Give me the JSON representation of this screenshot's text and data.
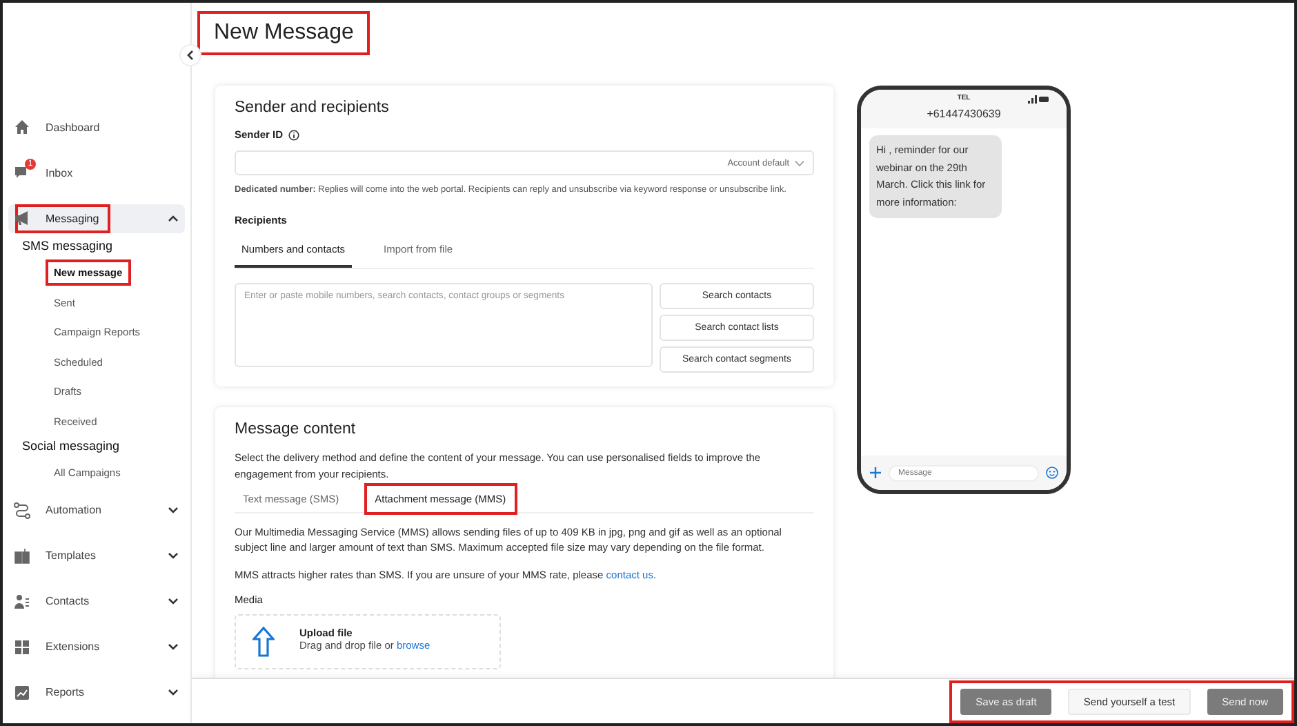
{
  "page": {
    "title": "New Message",
    "highlighted": true
  },
  "sidebar": {
    "items": [
      {
        "label": "Dashboard",
        "selected": false
      },
      {
        "label": "Inbox",
        "badge": "1",
        "selected": false
      },
      {
        "label": "Messaging",
        "selected": true,
        "expanded": true,
        "highlighted": true,
        "sections": [
          {
            "title": "SMS messaging",
            "children": [
              {
                "label": "New message",
                "selected": true,
                "highlighted": true
              },
              {
                "label": "Sent",
                "selected": false,
                "highlighted": false
              },
              {
                "label": "Campaign Reports",
                "selected": false,
                "highlighted": false
              },
              {
                "label": "Scheduled",
                "selected": false,
                "highlighted": false
              },
              {
                "label": "Drafts",
                "selected": false,
                "highlighted": false
              },
              {
                "label": "Received",
                "selected": false,
                "highlighted": false
              }
            ]
          },
          {
            "title": "Social messaging",
            "children": [
              {
                "label": "All Campaigns",
                "selected": false,
                "highlighted": false
              }
            ]
          }
        ]
      },
      {
        "label": "Automation",
        "selected": false,
        "expanded": false
      },
      {
        "label": "Templates",
        "selected": false,
        "expanded": false
      },
      {
        "label": "Contacts",
        "selected": false,
        "expanded": false
      },
      {
        "label": "Extensions",
        "selected": false,
        "expanded": false
      },
      {
        "label": "Reports",
        "selected": false,
        "expanded": false
      }
    ]
  },
  "sender_card": {
    "title": "Sender and recipients",
    "sender_label": "Sender ID",
    "sender_value": "Account default",
    "note": "**Dedicated number:** Replies will come into the web portal. Recipients can reply and unsubscribe via keyword response or unsubscribe link.",
    "recipients_label": "Recipients",
    "tabs": [
      {
        "label": "Numbers and contacts",
        "selected": true
      },
      {
        "label": "Import from file",
        "selected": false
      }
    ],
    "recipients_placeholder": "Enter or paste mobile numbers, search contacts, contact groups or segments",
    "buttons": [
      "Search contacts",
      "Search contact lists",
      "Search contact segments"
    ]
  },
  "content_card": {
    "title": "Message content",
    "intro": "Select the delivery method and define the content of your message. You can use personalised fields to improve the engagement from your recipients.",
    "tabs": [
      {
        "label": "Text message (SMS)",
        "selected": false,
        "highlighted": false
      },
      {
        "label": "Attachment message (MMS)",
        "selected": true,
        "highlighted": true
      }
    ],
    "description": "Our Multimedia Messaging Service (MMS) allows sending files of up to 409 KB in jpg, png and gif as well as an optional subject line and larger amount of text than SMS. Maximum accepted file size may vary depending on the file format.",
    "rate_text": "MMS attracts higher rates than SMS. If you are unsure of your MMS rate, please ",
    "rate_link": "contact us",
    "rate_end": ".",
    "media_label": "Media",
    "upload_title": "Upload file",
    "upload_text": "Drag and drop file or ",
    "upload_link": "browse"
  },
  "phone": {
    "carrier": "TEL",
    "number": "+61447430639",
    "bubble": "Hi , reminder for our webinar on the 29th March. Click this link for more information:",
    "input_placeholder": "Message"
  },
  "footer": {
    "highlighted": true,
    "buttons": [
      {
        "label": "Save as draft",
        "kind": "filled"
      },
      {
        "label": "Send yourself a test",
        "kind": "plain"
      },
      {
        "label": "Send now",
        "kind": "filled"
      }
    ]
  }
}
